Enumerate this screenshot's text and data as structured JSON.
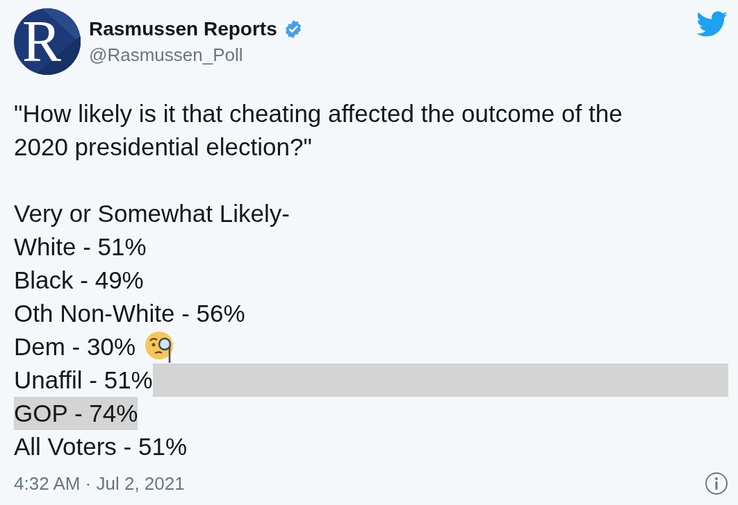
{
  "author": {
    "name": "Rasmussen Reports",
    "verified": true,
    "handle": "@Rasmussen_Poll",
    "avatar_letter": "R"
  },
  "question_lines": [
    "\"How likely is it that cheating affected the outcome of the",
    "2020 presidential election?\""
  ],
  "lines": [
    {
      "text": "Very or Somewhat Likely-",
      "selected": false,
      "line_end_selected": false,
      "monocle_emoji": false
    },
    {
      "text": "White - 51%",
      "selected": false,
      "line_end_selected": false,
      "monocle_emoji": false
    },
    {
      "text": "Black - 49%",
      "selected": false,
      "line_end_selected": false,
      "monocle_emoji": false
    },
    {
      "text": "Oth Non-White - 56%",
      "selected": false,
      "line_end_selected": false,
      "monocle_emoji": false
    },
    {
      "text": "Dem - 30%",
      "selected": false,
      "line_end_selected": false,
      "monocle_emoji": true
    },
    {
      "text": "Unaffil - 51%",
      "selected": false,
      "line_end_selected": true,
      "monocle_emoji": false
    },
    {
      "text": "GOP - 74%",
      "selected": true,
      "line_end_selected": false,
      "monocle_emoji": false
    },
    {
      "text": "All Voters - 51%",
      "selected": false,
      "line_end_selected": false,
      "monocle_emoji": false
    }
  ],
  "timestamp": "4:32 AM · Jul 2, 2021"
}
